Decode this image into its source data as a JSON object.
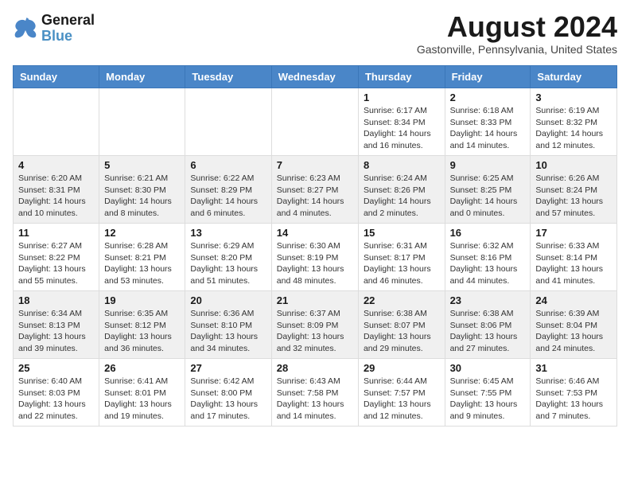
{
  "logo": {
    "line1": "General",
    "line2": "Blue"
  },
  "title": "August 2024",
  "subtitle": "Gastonville, Pennsylvania, United States",
  "days_of_week": [
    "Sunday",
    "Monday",
    "Tuesday",
    "Wednesday",
    "Thursday",
    "Friday",
    "Saturday"
  ],
  "weeks": [
    [
      {
        "day": "",
        "info": ""
      },
      {
        "day": "",
        "info": ""
      },
      {
        "day": "",
        "info": ""
      },
      {
        "day": "",
        "info": ""
      },
      {
        "day": "1",
        "info": "Sunrise: 6:17 AM\nSunset: 8:34 PM\nDaylight: 14 hours\nand 16 minutes."
      },
      {
        "day": "2",
        "info": "Sunrise: 6:18 AM\nSunset: 8:33 PM\nDaylight: 14 hours\nand 14 minutes."
      },
      {
        "day": "3",
        "info": "Sunrise: 6:19 AM\nSunset: 8:32 PM\nDaylight: 14 hours\nand 12 minutes."
      }
    ],
    [
      {
        "day": "4",
        "info": "Sunrise: 6:20 AM\nSunset: 8:31 PM\nDaylight: 14 hours\nand 10 minutes."
      },
      {
        "day": "5",
        "info": "Sunrise: 6:21 AM\nSunset: 8:30 PM\nDaylight: 14 hours\nand 8 minutes."
      },
      {
        "day": "6",
        "info": "Sunrise: 6:22 AM\nSunset: 8:29 PM\nDaylight: 14 hours\nand 6 minutes."
      },
      {
        "day": "7",
        "info": "Sunrise: 6:23 AM\nSunset: 8:27 PM\nDaylight: 14 hours\nand 4 minutes."
      },
      {
        "day": "8",
        "info": "Sunrise: 6:24 AM\nSunset: 8:26 PM\nDaylight: 14 hours\nand 2 minutes."
      },
      {
        "day": "9",
        "info": "Sunrise: 6:25 AM\nSunset: 8:25 PM\nDaylight: 14 hours\nand 0 minutes."
      },
      {
        "day": "10",
        "info": "Sunrise: 6:26 AM\nSunset: 8:24 PM\nDaylight: 13 hours\nand 57 minutes."
      }
    ],
    [
      {
        "day": "11",
        "info": "Sunrise: 6:27 AM\nSunset: 8:22 PM\nDaylight: 13 hours\nand 55 minutes."
      },
      {
        "day": "12",
        "info": "Sunrise: 6:28 AM\nSunset: 8:21 PM\nDaylight: 13 hours\nand 53 minutes."
      },
      {
        "day": "13",
        "info": "Sunrise: 6:29 AM\nSunset: 8:20 PM\nDaylight: 13 hours\nand 51 minutes."
      },
      {
        "day": "14",
        "info": "Sunrise: 6:30 AM\nSunset: 8:19 PM\nDaylight: 13 hours\nand 48 minutes."
      },
      {
        "day": "15",
        "info": "Sunrise: 6:31 AM\nSunset: 8:17 PM\nDaylight: 13 hours\nand 46 minutes."
      },
      {
        "day": "16",
        "info": "Sunrise: 6:32 AM\nSunset: 8:16 PM\nDaylight: 13 hours\nand 44 minutes."
      },
      {
        "day": "17",
        "info": "Sunrise: 6:33 AM\nSunset: 8:14 PM\nDaylight: 13 hours\nand 41 minutes."
      }
    ],
    [
      {
        "day": "18",
        "info": "Sunrise: 6:34 AM\nSunset: 8:13 PM\nDaylight: 13 hours\nand 39 minutes."
      },
      {
        "day": "19",
        "info": "Sunrise: 6:35 AM\nSunset: 8:12 PM\nDaylight: 13 hours\nand 36 minutes."
      },
      {
        "day": "20",
        "info": "Sunrise: 6:36 AM\nSunset: 8:10 PM\nDaylight: 13 hours\nand 34 minutes."
      },
      {
        "day": "21",
        "info": "Sunrise: 6:37 AM\nSunset: 8:09 PM\nDaylight: 13 hours\nand 32 minutes."
      },
      {
        "day": "22",
        "info": "Sunrise: 6:38 AM\nSunset: 8:07 PM\nDaylight: 13 hours\nand 29 minutes."
      },
      {
        "day": "23",
        "info": "Sunrise: 6:38 AM\nSunset: 8:06 PM\nDaylight: 13 hours\nand 27 minutes."
      },
      {
        "day": "24",
        "info": "Sunrise: 6:39 AM\nSunset: 8:04 PM\nDaylight: 13 hours\nand 24 minutes."
      }
    ],
    [
      {
        "day": "25",
        "info": "Sunrise: 6:40 AM\nSunset: 8:03 PM\nDaylight: 13 hours\nand 22 minutes."
      },
      {
        "day": "26",
        "info": "Sunrise: 6:41 AM\nSunset: 8:01 PM\nDaylight: 13 hours\nand 19 minutes."
      },
      {
        "day": "27",
        "info": "Sunrise: 6:42 AM\nSunset: 8:00 PM\nDaylight: 13 hours\nand 17 minutes."
      },
      {
        "day": "28",
        "info": "Sunrise: 6:43 AM\nSunset: 7:58 PM\nDaylight: 13 hours\nand 14 minutes."
      },
      {
        "day": "29",
        "info": "Sunrise: 6:44 AM\nSunset: 7:57 PM\nDaylight: 13 hours\nand 12 minutes."
      },
      {
        "day": "30",
        "info": "Sunrise: 6:45 AM\nSunset: 7:55 PM\nDaylight: 13 hours\nand 9 minutes."
      },
      {
        "day": "31",
        "info": "Sunrise: 6:46 AM\nSunset: 7:53 PM\nDaylight: 13 hours\nand 7 minutes."
      }
    ]
  ]
}
